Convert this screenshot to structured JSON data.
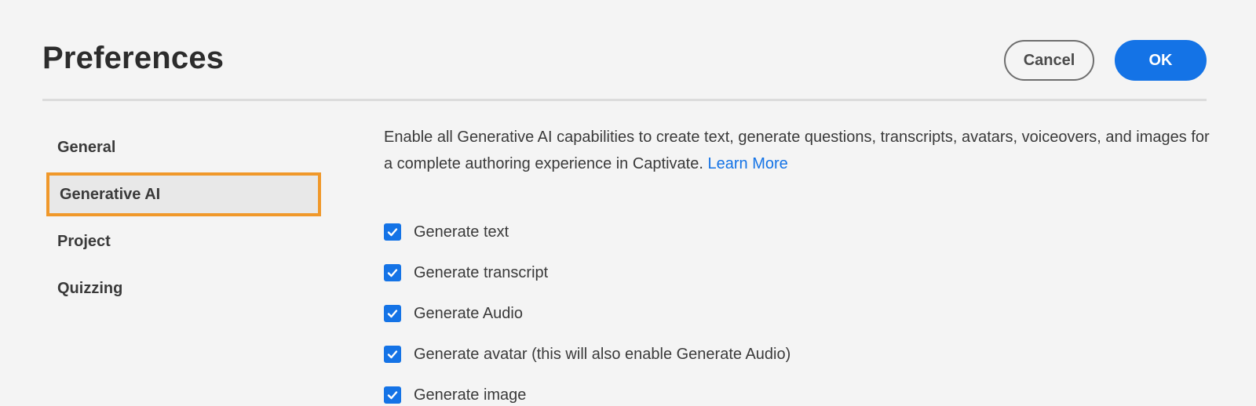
{
  "header": {
    "title": "Preferences",
    "cancel_label": "Cancel",
    "ok_label": "OK"
  },
  "sidebar": {
    "items": [
      {
        "label": "General",
        "selected": false
      },
      {
        "label": "Generative AI",
        "selected": true
      },
      {
        "label": "Project",
        "selected": false
      },
      {
        "label": "Quizzing",
        "selected": false
      }
    ]
  },
  "main": {
    "description": "Enable all Generative AI capabilities to create text, generate questions, transcripts, avatars, voiceovers, and images for a complete authoring experience in Captivate.",
    "learn_more": "Learn More",
    "options": [
      {
        "label": "Generate text",
        "checked": true
      },
      {
        "label": "Generate transcript",
        "checked": true
      },
      {
        "label": "Generate Audio",
        "checked": true
      },
      {
        "label": "Generate avatar (this will also enable Generate Audio)",
        "checked": true
      },
      {
        "label": "Generate image",
        "checked": true
      }
    ]
  },
  "colors": {
    "accent": "#1473e6",
    "highlight_border": "#f0982a",
    "background": "#f4f4f4"
  },
  "icons": {
    "checkbox_checked": "checkmark-icon"
  }
}
